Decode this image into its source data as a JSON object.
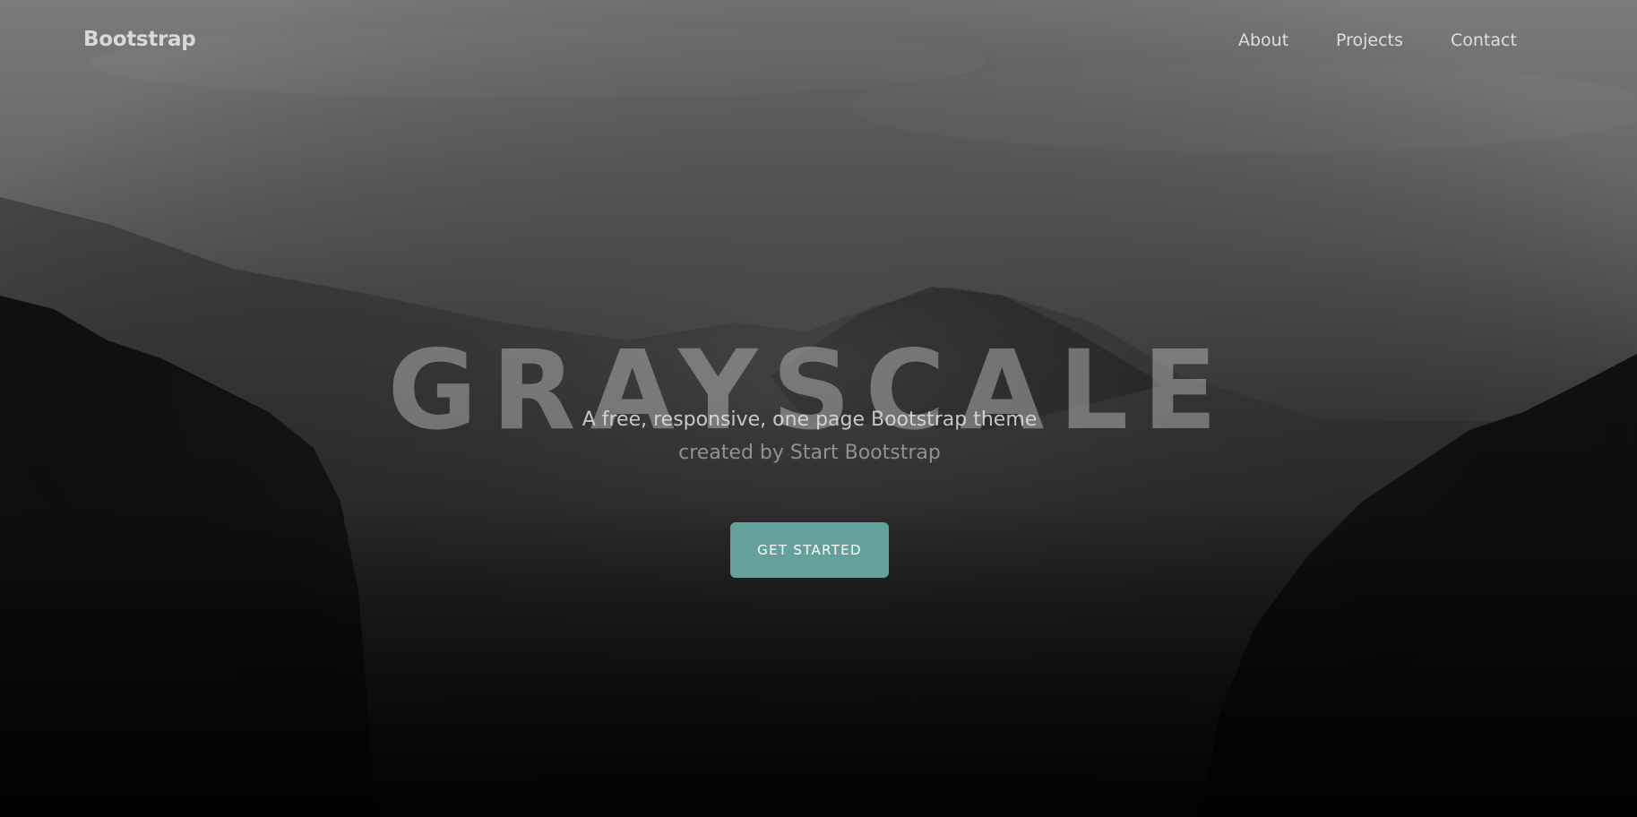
{
  "navbar": {
    "brand": "Bootstrap",
    "links": [
      {
        "label": "About"
      },
      {
        "label": "Projects"
      },
      {
        "label": "Contact"
      }
    ]
  },
  "masthead": {
    "title": "GRAYSCALE",
    "subtitle_line1": "A free, responsive, one page Bootstrap theme",
    "subtitle_line2": "created by Start Bootstrap",
    "button_label": "GET STARTED"
  },
  "colors": {
    "accent": "#64a19d",
    "background": "#000000"
  }
}
